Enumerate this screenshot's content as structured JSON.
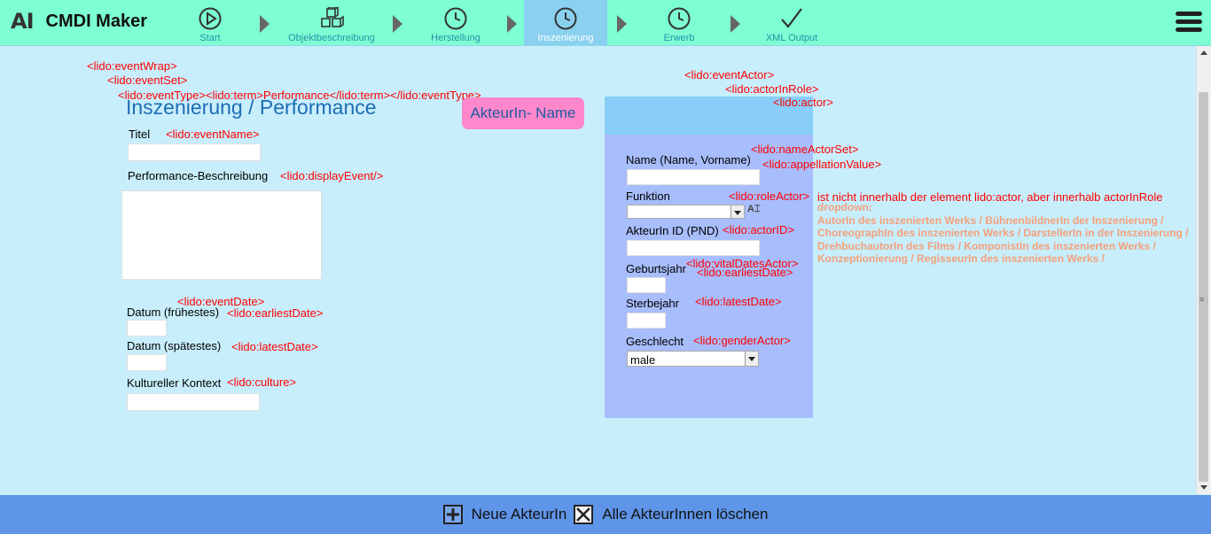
{
  "app": {
    "logo": "AI",
    "title": "CMDI Maker"
  },
  "steps": [
    {
      "label": "Start",
      "icon": "play-icon"
    },
    {
      "label": "Objektbeschreibung",
      "icon": "cubes-icon"
    },
    {
      "label": "Herstellung",
      "icon": "clock-icon"
    },
    {
      "label": "Inszenierung",
      "icon": "clock-icon",
      "active": true
    },
    {
      "label": "Erwerb",
      "icon": "clock-icon"
    },
    {
      "label": "XML Output",
      "icon": "checkmark-icon"
    }
  ],
  "event": {
    "tags": {
      "eventWrap": "<lido:eventWrap>",
      "eventSet": "<lido:eventSet>",
      "eventType": "<lido:eventType><lido:term>Performance</lido:term></lido:eventType>",
      "eventName": "<lido:eventName>",
      "displayEvent": "<lido:displayEvent/>",
      "eventDate": "<lido:eventDate>",
      "earliestDate": "<lido:earliestDate>",
      "latestDate": "<lido:latestDate>",
      "culture": "<lido:culture>"
    },
    "heading": "Inszenierung / Performance",
    "title_label": "Titel",
    "description_label": "Performance-Beschreibung",
    "date_earliest_label": "Datum (frühestes)",
    "date_latest_label": "Datum (spätestes)",
    "culture_label": "Kultureller Kontext"
  },
  "actor": {
    "button": "AkteurIn- Name",
    "tags": {
      "eventActor": "<lido:eventActor>",
      "actorInRole": "<lido:actorInRole>",
      "actor": "<lido:actor>",
      "nameActorSet": "<lido:nameActorSet>",
      "appellationValue": "<lido:appellationValue>",
      "roleActor": "<lido:roleActor>",
      "actorID": "<lido:actorID>",
      "vitalDatesActor": "<lido:vitalDatesActor>",
      "earliestDate": "<lido:earliestDate>",
      "latestDate": "<lido:latestDate>",
      "genderActor": "<lido:genderActor>"
    },
    "name_label": "Name (Name, Vorname)",
    "function_label": "Funktion",
    "id_label": "AkteurIn ID (PND)",
    "birth_label": "Geburtsjahr",
    "death_label": "Sterbejahr",
    "gender_label": "Geschlecht",
    "gender_value": "male",
    "role_note": "ist nicht innerhalb der element lido:actor, aber innerhalb actorInRole",
    "dropdown_note": [
      "dropdown:",
      "AutorIn des inszenierten Werks / BühnenbildnerIn der Inszenierung /",
      "ChoreographIn des inszenierten Werks / DarstellerIn in der Inszenierung /",
      "DrehbuchautorIn des Films / KomponistIn des inszenierten Werks /",
      "Konzeptionierung / RegisseurIn des inszenierten Werks /"
    ]
  },
  "footer": {
    "new_actor": "Neue AkteurIn",
    "delete_all": "Alle  AkteurInnen  löschen"
  }
}
